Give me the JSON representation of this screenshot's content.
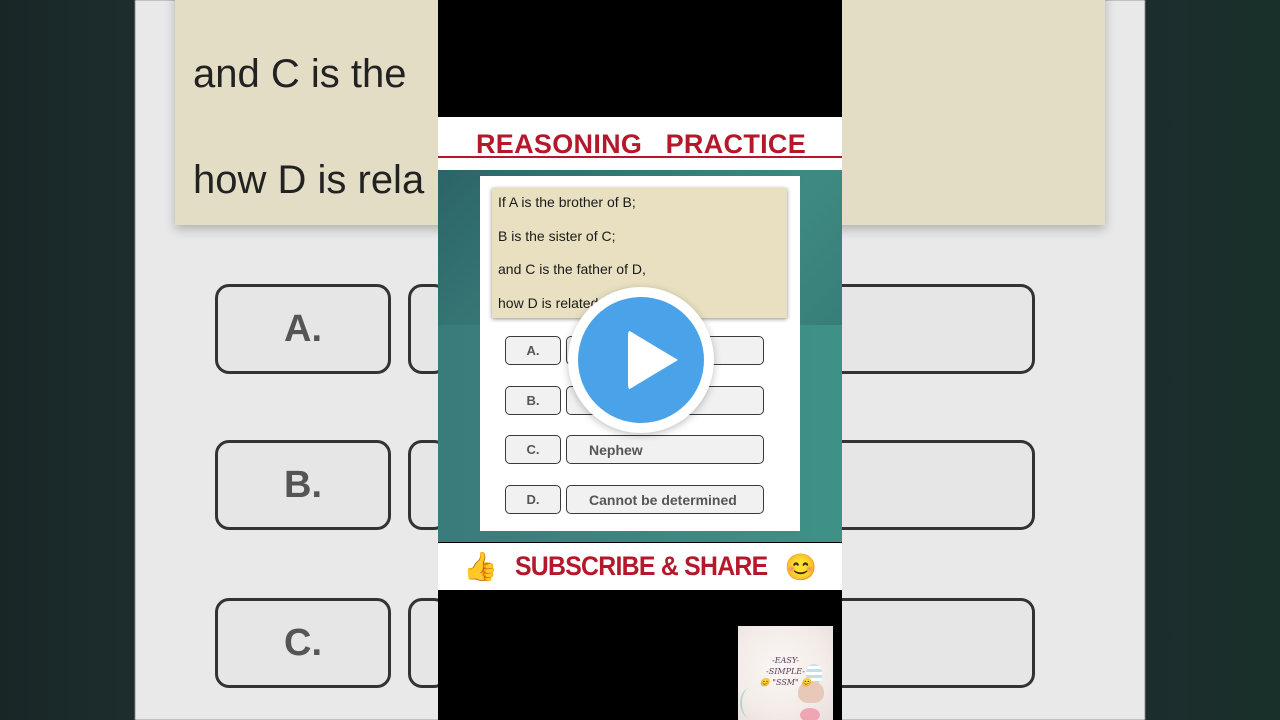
{
  "video": {
    "title": "REASONING   PRACTICE",
    "question_lines": [
      "If A is the brother of B;",
      "B is the sister of C;",
      "and C is the father of D,",
      "how D is related"
    ],
    "options": [
      {
        "letter": "A.",
        "answer": ""
      },
      {
        "letter": "B.",
        "answer": ""
      },
      {
        "letter": "C.",
        "answer": "Nephew"
      },
      {
        "letter": "D.",
        "answer": "Cannot be determined"
      }
    ],
    "subscribe": {
      "thumb_icon": "👍",
      "text": "SUBSCRIBE & SHARE",
      "smile_icon": "😊"
    },
    "channel_logo": {
      "line1": "-EASY-",
      "line2": "-SIMPLE-",
      "line3": "😊 \"SSM\" 😊"
    }
  },
  "background": {
    "note_lines": [
      "and C is the",
      "how D is rela"
    ],
    "option_letters": [
      "A.",
      "B.",
      "C."
    ]
  },
  "colors": {
    "title_red": "#b5182a",
    "play_blue": "#4aa3e8",
    "note_beige": "#e8e0c1"
  }
}
